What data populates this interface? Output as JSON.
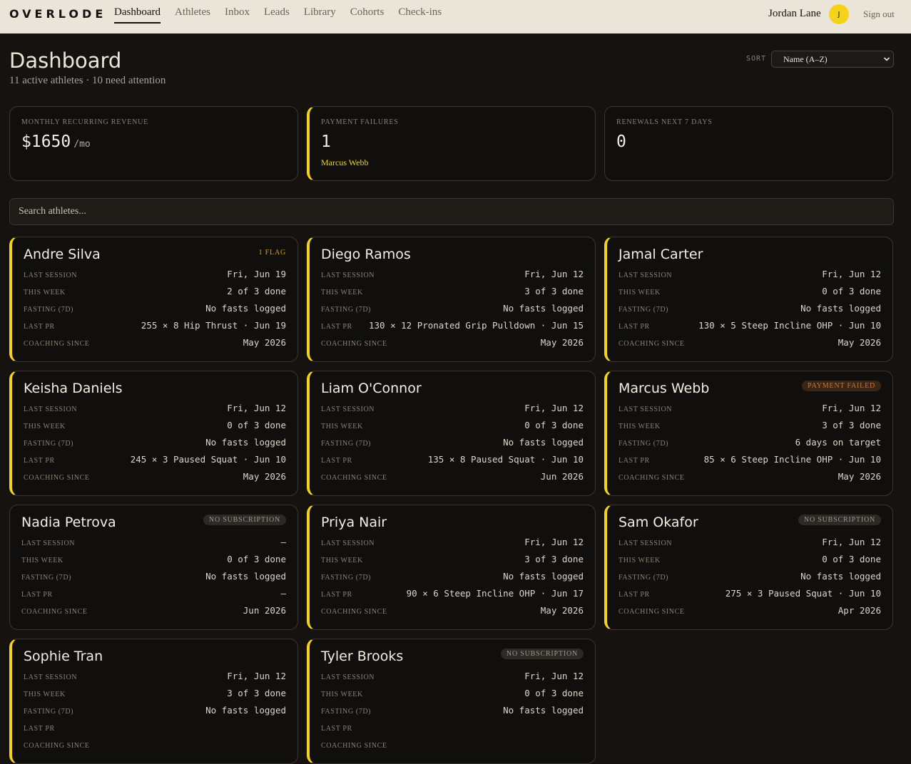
{
  "app": {
    "brand": "OVERLODE",
    "nav": [
      "Dashboard",
      "Athletes",
      "Inbox",
      "Leads",
      "Library",
      "Cohorts",
      "Check-ins"
    ],
    "active_nav": "Dashboard",
    "user": {
      "name": "Jordan Lane",
      "initial": "J"
    },
    "signout": "Sign out"
  },
  "header": {
    "title": "Dashboard",
    "subtitle": "11 active athletes · 10 need attention",
    "sort_label": "SORT",
    "sort_value": "Name (A–Z)"
  },
  "kpis": [
    {
      "label": "Monthly recurring revenue",
      "value": "$1650",
      "unit": "/mo",
      "note": ""
    },
    {
      "label": "Payment failures",
      "value": "1",
      "unit": "",
      "note": "Marcus Webb"
    },
    {
      "label": "Renewals next 7 days",
      "value": "0",
      "unit": "",
      "note": ""
    }
  ],
  "search": {
    "placeholder": "Search athletes..."
  },
  "row_labels": [
    "Last session",
    "This week",
    "Fasting (7d)",
    "Last PR",
    "Coaching since"
  ],
  "athletes": [
    {
      "name": "Andre Silva",
      "badge": "1 FLAG",
      "badge_type": "flag",
      "flagged": true,
      "last_session": "Fri, Jun 19",
      "this_week": "2 of 3 done",
      "fasting": "No fasts logged",
      "last_pr": "255 × 8 Hip Thrust · Jun 19",
      "coaching_since": "May 2026"
    },
    {
      "name": "Diego Ramos",
      "badge": "",
      "badge_type": "",
      "flagged": true,
      "last_session": "Fri, Jun 12",
      "this_week": "3 of 3 done",
      "fasting": "No fasts logged",
      "last_pr": "130 × 12 Pronated Grip Pulldown · Jun 15",
      "coaching_since": "May 2026"
    },
    {
      "name": "Jamal Carter",
      "badge": "",
      "badge_type": "",
      "flagged": true,
      "last_session": "Fri, Jun 12",
      "this_week": "0 of 3 done",
      "fasting": "No fasts logged",
      "last_pr": "130 × 5 Steep Incline OHP · Jun 10",
      "coaching_since": "May 2026"
    },
    {
      "name": "Keisha Daniels",
      "badge": "",
      "badge_type": "",
      "flagged": true,
      "last_session": "Fri, Jun 12",
      "this_week": "0 of 3 done",
      "fasting": "No fasts logged",
      "last_pr": "245 × 3 Paused Squat · Jun 10",
      "coaching_since": "May 2026"
    },
    {
      "name": "Liam O'Connor",
      "badge": "",
      "badge_type": "",
      "flagged": true,
      "last_session": "Fri, Jun 12",
      "this_week": "0 of 3 done",
      "fasting": "No fasts logged",
      "last_pr": "135 × 8 Paused Squat · Jun 10",
      "coaching_since": "Jun 2026"
    },
    {
      "name": "Marcus Webb",
      "badge": "PAYMENT FAILED",
      "badge_type": "fail",
      "flagged": true,
      "last_session": "Fri, Jun 12",
      "this_week": "3 of 3 done",
      "fasting": "6 days on target",
      "last_pr": "85 × 6 Steep Incline OHP · Jun 10",
      "coaching_since": "May 2026"
    },
    {
      "name": "Nadia Petrova",
      "badge": "NO SUBSCRIPTION",
      "badge_type": "pill",
      "flagged": false,
      "last_session": "—",
      "this_week": "0 of 3 done",
      "fasting": "No fasts logged",
      "last_pr": "—",
      "coaching_since": "Jun 2026"
    },
    {
      "name": "Priya Nair",
      "badge": "",
      "badge_type": "",
      "flagged": true,
      "last_session": "Fri, Jun 12",
      "this_week": "3 of 3 done",
      "fasting": "No fasts logged",
      "last_pr": "90 × 6 Steep Incline OHP · Jun 17",
      "coaching_since": "May 2026"
    },
    {
      "name": "Sam Okafor",
      "badge": "NO SUBSCRIPTION",
      "badge_type": "pill",
      "flagged": true,
      "last_session": "Fri, Jun 12",
      "this_week": "0 of 3 done",
      "fasting": "No fasts logged",
      "last_pr": "275 × 3 Paused Squat · Jun 10",
      "coaching_since": "Apr 2026"
    },
    {
      "name": "Sophie Tran",
      "badge": "",
      "badge_type": "",
      "flagged": true,
      "last_session": "Fri, Jun 12",
      "this_week": "3 of 3 done",
      "fasting": "No fasts logged",
      "last_pr": "",
      "coaching_since": ""
    },
    {
      "name": "Tyler Brooks",
      "badge": "NO SUBSCRIPTION",
      "badge_type": "pill",
      "flagged": true,
      "last_session": "Fri, Jun 12",
      "this_week": "0 of 3 done",
      "fasting": "No fasts logged",
      "last_pr": "",
      "coaching_since": ""
    }
  ],
  "colors": {
    "accent": "#f5d31a",
    "background": "#151210",
    "card": "#110f0d",
    "topbar": "#ebe5d9",
    "flag_text": "#d99b2b",
    "fail_text": "#c27a37"
  }
}
